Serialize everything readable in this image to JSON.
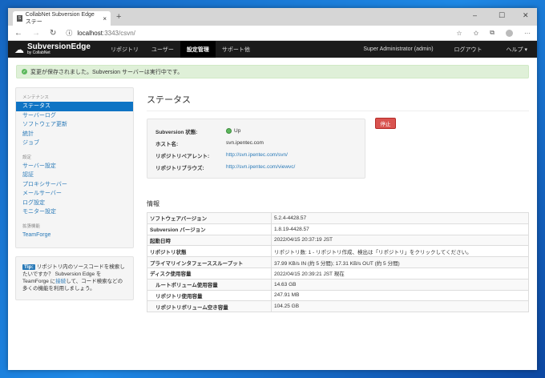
{
  "browser": {
    "tab_title": "CollabNet Subversion Edge ステー",
    "url_host": "localhost",
    "url_path": ":3343/csvn/"
  },
  "nav": {
    "logo_title": "SubversionEdge",
    "logo_sub": "by CollabNet",
    "items": [
      "リポジトリ",
      "ユーザー",
      "設定管理",
      "サポート他"
    ],
    "user": "Super Administrator (admin)",
    "logout": "ログアウト",
    "help": "ヘルプ ▾"
  },
  "alert": "変更が保存されました。Subversion サーバーは実行中です。",
  "sidebar": {
    "sections": [
      {
        "header": "メンテナンス",
        "items": [
          "ステータス",
          "サーバーログ",
          "ソフトウェア更新",
          "統計",
          "ジョブ"
        ]
      },
      {
        "header": "設定",
        "items": [
          "サーバー設定",
          "認証",
          "プロキシサーバー",
          "メールサーバー",
          "ログ設定",
          "モニター設定"
        ]
      },
      {
        "header": "拡張機能",
        "items": [
          "TeamForge"
        ]
      }
    ]
  },
  "tip": {
    "label": "Tip:",
    "text1": "リポジトリ内のソースコードを検索したいですか？ Subversion Edge を TeamForge に",
    "link": "接続",
    "text2": "して、コード検索などの多くの機能を利用しましょう。"
  },
  "main": {
    "title": "ステータス",
    "stop_button": "停止",
    "status": [
      {
        "label": "Subversion 状態:",
        "value": "Up"
      },
      {
        "label": "ホスト名:",
        "value": "svn.ipentec.com"
      },
      {
        "label": "リポジトリペアレント:",
        "value": "http://svn.ipentec.com/svn/"
      },
      {
        "label": "リポジトリブラウズ:",
        "value": "http://svn.ipentec.com/viewvc/"
      }
    ],
    "info_title": "情報",
    "info": [
      {
        "label": "ソフトウェアバージョン",
        "value": "5.2.4-4428.57"
      },
      {
        "label": "Subversion バージョン",
        "value": "1.8.19-4428.57"
      },
      {
        "label": "起動日時",
        "value": "2022/04/15 20:37:19 JST"
      },
      {
        "label": "リポジトリ状態",
        "value": "リポジトリ数: 1 - リポジトリ作成、検出は「リポジトリ」をクリックしてください。"
      },
      {
        "label": "プライマリインタフェーススループット",
        "value": "37.99 KB/s IN (約 5 分間); 17.31 KB/s OUT (約 5 分間)"
      },
      {
        "label": "ディスク使用容量",
        "value": "2022/04/15 20:39:21 JST 現在"
      },
      {
        "label": "ルートボリューム使用容量",
        "value": "14.63 GB"
      },
      {
        "label": "リポジトリ使用容量",
        "value": "247.91 MB"
      },
      {
        "label": "リポジトリボリューム空き容量",
        "value": "104.25 GB"
      }
    ]
  }
}
